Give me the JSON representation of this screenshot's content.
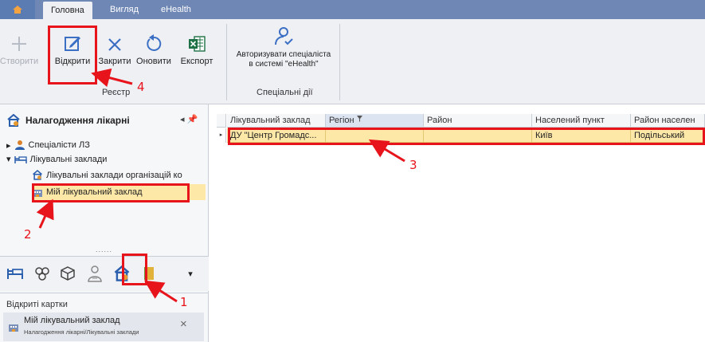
{
  "titlebar": {
    "tabs": [
      {
        "label": "Головна",
        "active": true
      },
      {
        "label": "Вигляд",
        "active": false
      },
      {
        "label": "eHealth",
        "active": false
      }
    ]
  },
  "ribbon": {
    "buttons": [
      {
        "label": "Створити",
        "icon": "plus-icon",
        "disabled": true
      },
      {
        "label": "Відкрити",
        "icon": "edit-icon",
        "disabled": false
      },
      {
        "label": "Закрити",
        "icon": "close-icon",
        "disabled": false
      },
      {
        "label": "Оновити",
        "icon": "refresh-icon",
        "disabled": false
      },
      {
        "label": "Експорт",
        "icon": "excel-export-icon",
        "disabled": false
      }
    ],
    "group1_label": "Реєстр",
    "auth_button": {
      "line1": "Авторизувати спеціаліста",
      "line2": "в системі \"eHealth\""
    },
    "group2_label": "Спеціальні дії"
  },
  "nav": {
    "title": "Налагодження лікарні",
    "pin_label": "◂ 📌",
    "tree": [
      {
        "label": "Спеціалісти ЛЗ",
        "expander": "▸"
      },
      {
        "label": "Лікувальні заклади",
        "expander": "▾"
      },
      {
        "label": "Лікувальні заклади організацій ко"
      },
      {
        "label": "Мій лікувальний заклад",
        "selected": true
      }
    ],
    "grip": "......",
    "iconbar": [
      "bed-icon",
      "molecule-icon",
      "cube-icon",
      "doctor-icon",
      "hospital-settings-icon",
      "book-icon",
      "dropdown-icon"
    ],
    "iconbar_more": "▾"
  },
  "open_cards": {
    "title": "Відкриті картки",
    "card_name": "Мій лікувальний заклад",
    "card_path": "Налагодження лікарні/Лікувальні заклади",
    "close": "×"
  },
  "grid": {
    "columns": [
      "Лікувальний заклад",
      "Регіон",
      "Район",
      "Населений пункт",
      "Район населен"
    ],
    "row_indicator": "▸",
    "rows": [
      [
        "ДУ \"Центр Громадс...",
        "",
        "",
        "Київ",
        "Подільський"
      ]
    ]
  },
  "annotations": [
    "1",
    "2",
    "3",
    "4"
  ],
  "colors": {
    "highlight": "#e8141c",
    "titlebar": "#6f87b5",
    "selection": "#fde8a8"
  }
}
